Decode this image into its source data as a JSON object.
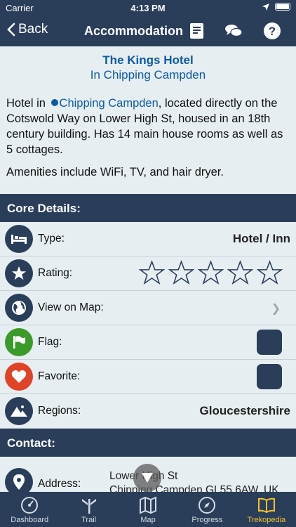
{
  "status": {
    "carrier": "Carrier",
    "time": "4:13 PM"
  },
  "nav": {
    "back_label": "Back",
    "title": "Accommodation"
  },
  "hotel": {
    "name": "The Kings Hotel",
    "location_line": "In Chipping Campden",
    "desc_prefix": "Hotel in ",
    "desc_link": "Chipping Campden",
    "desc_suffix": ", located directly on the Cotswold Way on Lower High St, housed in an 18th century building. Has 14 main house rooms as well as 5 cottages.",
    "amenities": "Amenities include WiFi, TV, and hair dryer."
  },
  "sections": {
    "core": "Core Details:",
    "contact": "Contact:"
  },
  "core": {
    "type_label": "Type:",
    "type_value": "Hotel / Inn",
    "rating_label": "Rating:",
    "rating_value": 0,
    "rating_max": 5,
    "map_label": "View on Map:",
    "flag_label": "Flag:",
    "flag_checked": false,
    "favorite_label": "Favorite:",
    "favorite_checked": false,
    "regions_label": "Regions:",
    "regions_value": "Gloucestershire"
  },
  "contact": {
    "address_label": "Address:",
    "address_line1": "Lower High St",
    "address_line2": "Chipping Campden GL55 6AW, UK"
  },
  "tabs": [
    {
      "label": "Dashboard",
      "icon": "gauge-icon"
    },
    {
      "label": "Trail",
      "icon": "signpost-icon"
    },
    {
      "label": "Map",
      "icon": "map-icon"
    },
    {
      "label": "Progress",
      "icon": "compass-icon"
    },
    {
      "label": "Trekopedia",
      "icon": "book-icon"
    }
  ],
  "colors": {
    "navy": "#2a3e5a",
    "link": "#0d5aa5",
    "active_tab": "#f2c230",
    "flag_green": "#3c9a2a",
    "favorite_red": "#e04326"
  }
}
